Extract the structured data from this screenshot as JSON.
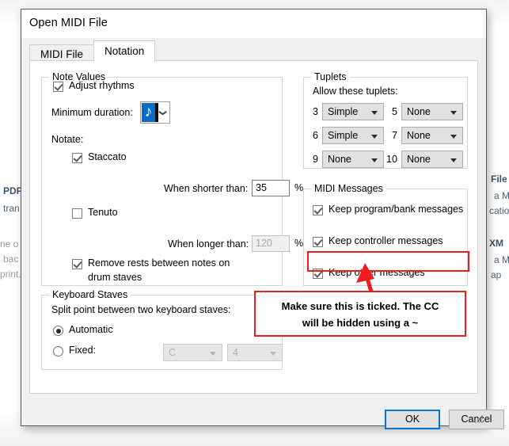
{
  "background": {
    "left_fragments": [
      "PDF",
      "tran",
      "ne o",
      "bac",
      "print."
    ],
    "right_fragments": [
      "File",
      "a M",
      "catio",
      "XM",
      "a M",
      "ap"
    ]
  },
  "dialog": {
    "title": "Open MIDI File",
    "tabs": [
      {
        "label": "MIDI File",
        "active": false
      },
      {
        "label": "Notation",
        "active": true
      }
    ],
    "note_values": {
      "legend": "Note Values",
      "adjust_rhythms": {
        "label": "Adjust rhythms",
        "checked": true
      },
      "minimum_duration": {
        "label": "Minimum duration:",
        "value": "♪",
        "icon": "eighth-note-glyph"
      },
      "notate_label": "Notate:",
      "staccato": {
        "label": "Staccato",
        "checked": true
      },
      "when_shorter_than": {
        "label": "When shorter than:",
        "value": "35",
        "unit": "%",
        "disabled": false
      },
      "tenuto": {
        "label": "Tenuto",
        "checked": false
      },
      "when_longer_than": {
        "label": "When longer than:",
        "value": "120",
        "unit": "%",
        "disabled": true
      },
      "remove_rests": {
        "label_line1": "Remove rests between notes on",
        "label_line2": "drum staves",
        "checked": true
      }
    },
    "keyboard_staves": {
      "legend": "Keyboard Staves",
      "split_label": "Split point between two keyboard staves:",
      "automatic": {
        "label": "Automatic",
        "selected": true
      },
      "fixed": {
        "label": "Fixed:",
        "selected": false
      },
      "fixed_note": {
        "value": "C",
        "disabled": true
      },
      "fixed_octave": {
        "value": "4",
        "disabled": true
      }
    },
    "tuplets": {
      "legend": "Tuplets",
      "allow_label": "Allow these tuplets:",
      "rows": [
        {
          "left_number": "3",
          "left_value": "Simple",
          "right_number": "5",
          "right_value": "None"
        },
        {
          "left_number": "6",
          "left_value": "Simple",
          "right_number": "7",
          "right_value": "None"
        },
        {
          "left_number": "9",
          "left_value": "None",
          "right_number": "10",
          "right_value": "None"
        }
      ]
    },
    "midi_messages": {
      "legend": "MIDI Messages",
      "items": [
        {
          "label": "Keep program/bank messages",
          "checked": true
        },
        {
          "label": "Keep controller messages",
          "checked": true
        },
        {
          "label": "Keep other messages",
          "checked": true
        }
      ]
    },
    "buttons": {
      "ok": "OK",
      "cancel": "Cancel"
    }
  },
  "annotation": {
    "line1": "Make sure this is ticked. The CC",
    "line2": "will be hidden using a ~",
    "color": "#ee1c1c",
    "highlight_target": "Keep controller messages"
  }
}
